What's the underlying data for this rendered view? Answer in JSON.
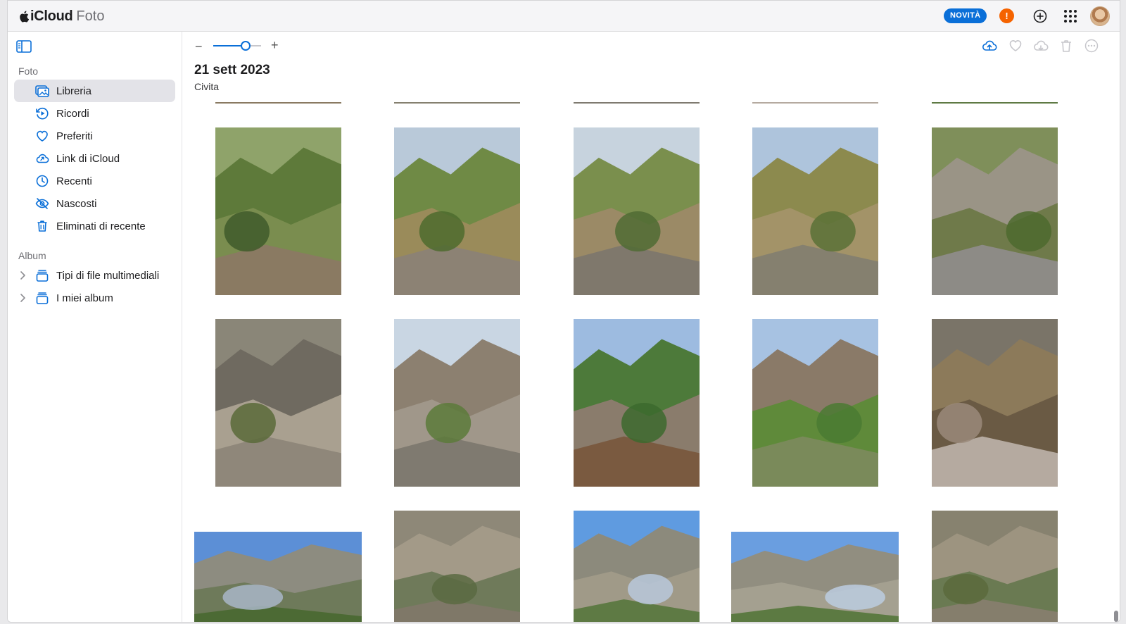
{
  "header": {
    "brand_name": "iCloud",
    "app_name": "Foto",
    "news_badge": "NOVITÀ",
    "alert_symbol": "!"
  },
  "sidebar": {
    "section_foto": "Foto",
    "section_album": "Album",
    "items": [
      {
        "label": "Libreria",
        "icon": "photo-library-icon",
        "active": true
      },
      {
        "label": "Ricordi",
        "icon": "memories-icon"
      },
      {
        "label": "Preferiti",
        "icon": "heart-icon"
      },
      {
        "label": "Link di iCloud",
        "icon": "icloud-link-icon"
      },
      {
        "label": "Recenti",
        "icon": "clock-icon"
      },
      {
        "label": "Nascosti",
        "icon": "hidden-eye-icon"
      },
      {
        "label": "Eliminati di recente",
        "icon": "trash-icon"
      }
    ],
    "albums": [
      {
        "label": "Tipi di file multimediali",
        "icon": "album-stack-icon"
      },
      {
        "label": "I miei album",
        "icon": "album-stack-icon"
      }
    ]
  },
  "toolbar": {
    "zoom_minus": "−",
    "zoom_plus": "+",
    "zoom_level": 0.68,
    "actions": [
      "upload-icon",
      "favorite-heart-icon",
      "download-icon",
      "delete-trash-icon",
      "more-ellipsis-icon"
    ]
  },
  "content": {
    "date": "21 sett 2023",
    "location": "Civita"
  },
  "colors": {
    "accent": "#0a6fd8",
    "alert": "#f56300",
    "active_item_bg": "#e3e3e8"
  }
}
